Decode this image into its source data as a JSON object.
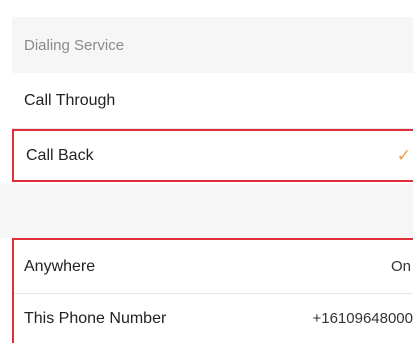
{
  "dialing_service": {
    "header": "Dialing Service",
    "options": [
      {
        "label": "Call Through",
        "selected": false
      },
      {
        "label": "Call Back",
        "selected": true,
        "mark": "✓"
      }
    ]
  },
  "routing": {
    "anywhere_label": "Anywhere",
    "anywhere_value": "On",
    "phone_label": "This Phone Number",
    "phone_value": "+16109648000"
  },
  "colors": {
    "highlight_border": "#e02f3a",
    "checkmark": "#f19a3e",
    "section_bg": "#f6f6f6"
  }
}
